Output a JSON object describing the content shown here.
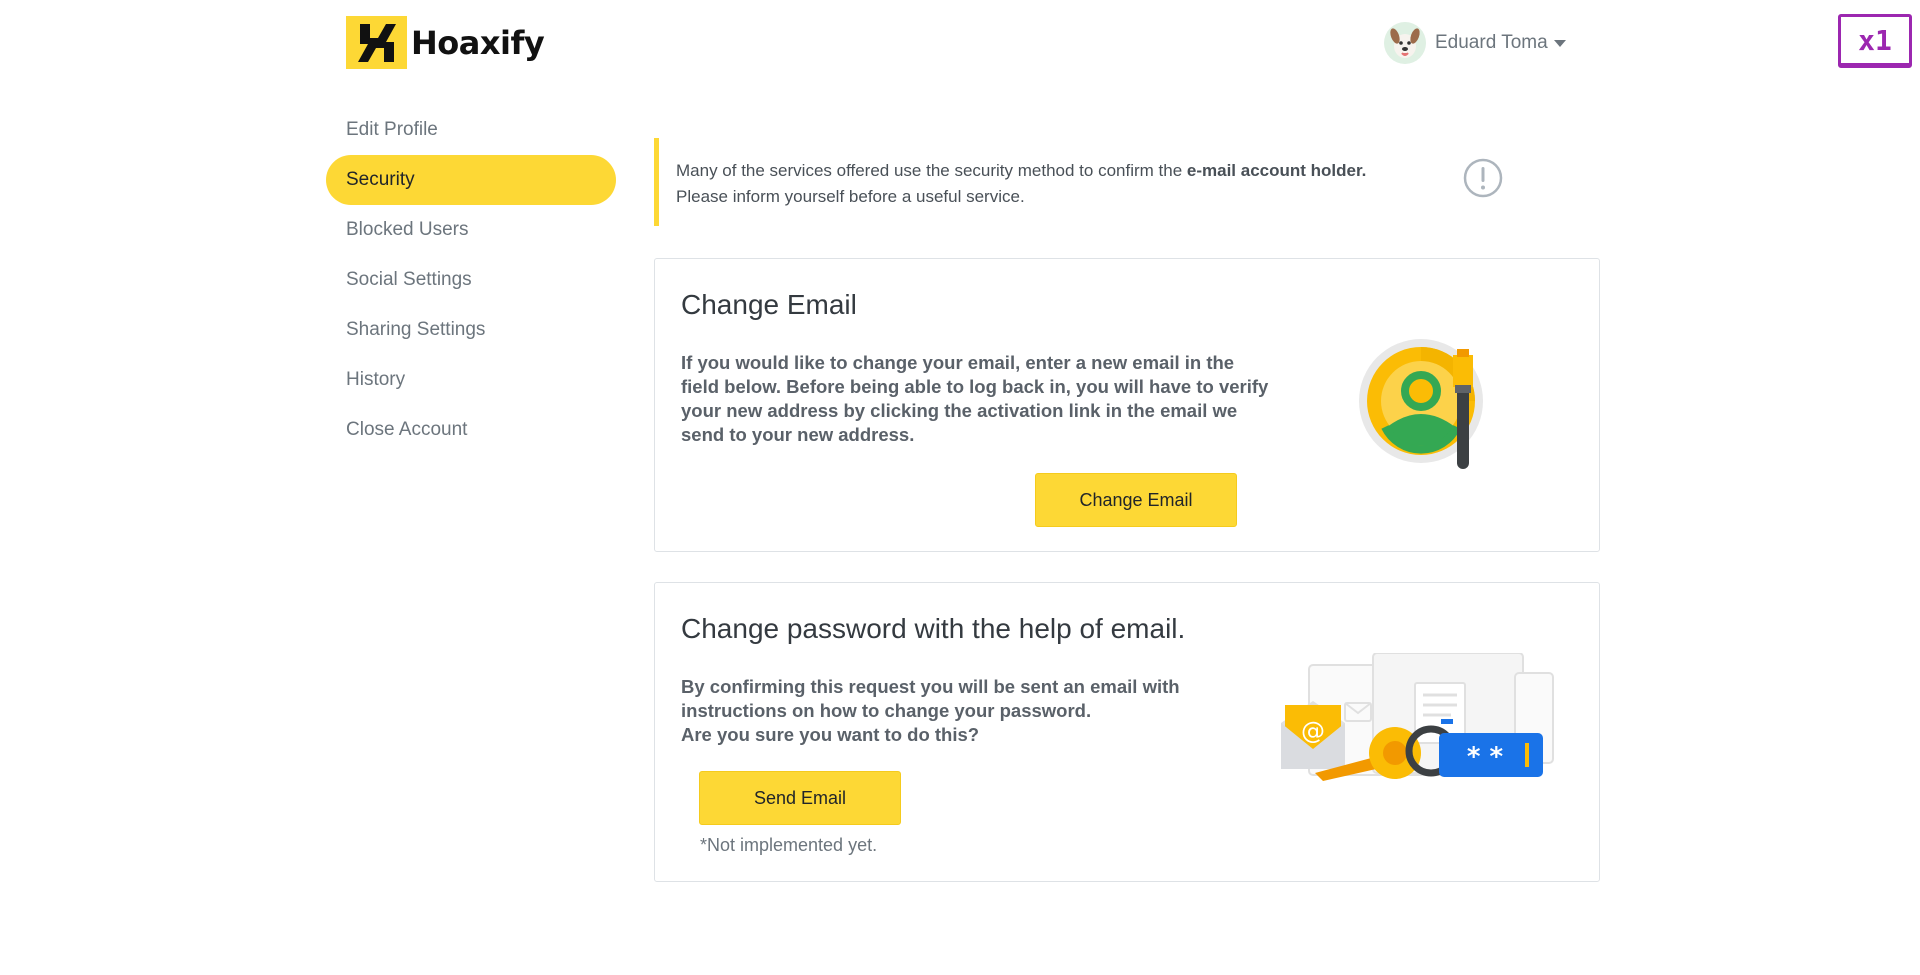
{
  "header": {
    "brand": "Hoaxify",
    "user_name": "Eduard Toma",
    "lang_badge": "x1"
  },
  "sidebar": {
    "items": [
      {
        "label": "Edit Profile",
        "active": false
      },
      {
        "label": "Security",
        "active": true
      },
      {
        "label": "Blocked Users",
        "active": false
      },
      {
        "label": "Social Settings",
        "active": false
      },
      {
        "label": "Sharing Settings",
        "active": false
      },
      {
        "label": "History",
        "active": false
      },
      {
        "label": "Close Account",
        "active": false
      }
    ]
  },
  "alert": {
    "text_before": "Many of the services offered use the security method to confirm the ",
    "text_bold": "e-mail account holder.",
    "text_line2": "Please inform yourself before a useful service.",
    "icon": "exclamation-circle-icon"
  },
  "change_email": {
    "title": "Change Email",
    "body": "If you would like to change your email, enter a new email in the field below. Before being able to log back in, you will have to verify your new address by clicking the activation link in the email we send to your new address.",
    "button": "Change Email"
  },
  "change_password": {
    "title": "Change password with the help of email.",
    "body_line1": "By confirming this request you will be sent an email with instructions on how to change your password.",
    "body_line2": "Are you sure you want to do this?",
    "button": "Send Email",
    "note": "*Not implemented yet."
  },
  "colors": {
    "accent": "#fdd835",
    "badge": "#9c27b0",
    "text": "#495057"
  }
}
